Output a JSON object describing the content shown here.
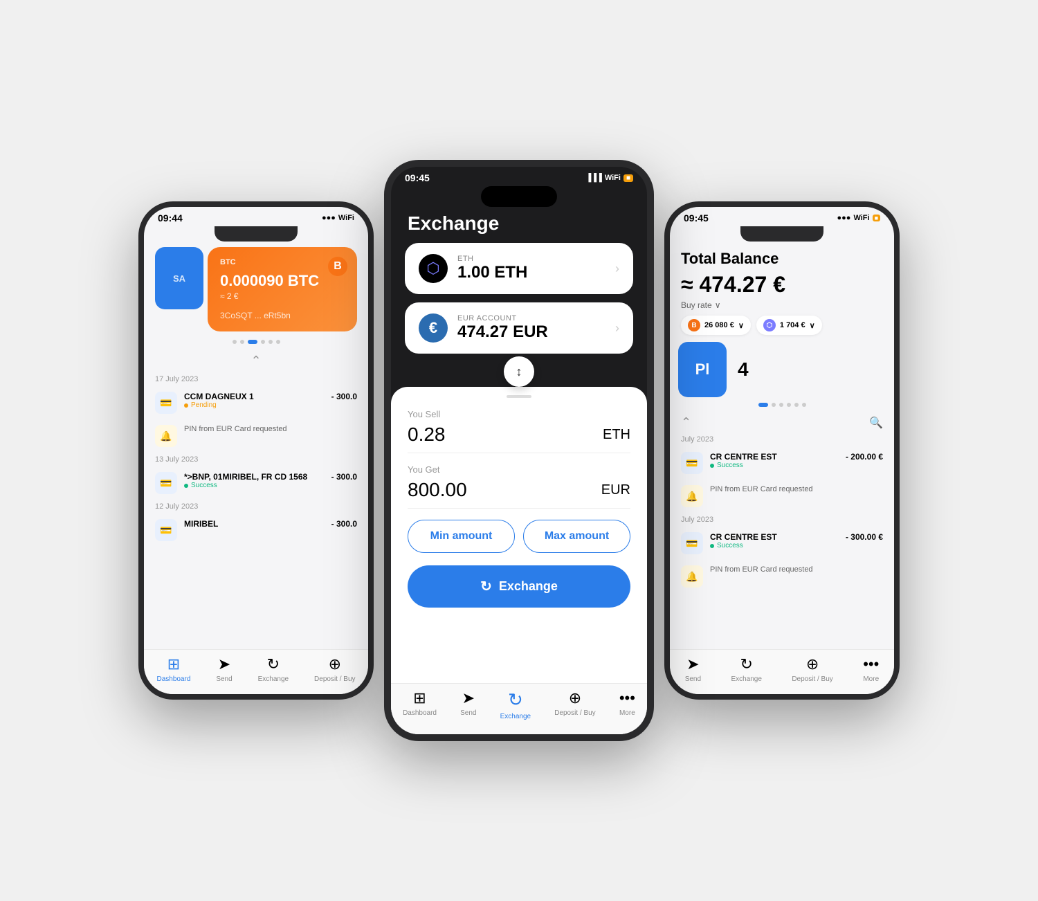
{
  "scene": {
    "background": "#e8e8ea"
  },
  "left_phone": {
    "status_time": "09:44",
    "status_signal": "●●●",
    "status_wifi": "WiFi",
    "card": {
      "label": "BTC",
      "badge": "B",
      "amount": "0.000090 BTC",
      "eur_approx": "≈ 2 €",
      "address": "3CoSQT ... eRt5bn"
    },
    "dots": [
      "dot",
      "dot",
      "dot-active",
      "dot",
      "dot",
      "dot"
    ],
    "transactions": [
      {
        "date": "17 July 2023",
        "items": [
          {
            "type": "card",
            "name": "CCM DAGNEUX 1",
            "amount": "- 300.0",
            "status": "Pending",
            "status_type": "pending"
          },
          {
            "type": "bell",
            "name": "PIN from EUR Card requested",
            "amount": "",
            "status": "",
            "status_type": "none"
          }
        ]
      },
      {
        "date": "13 July 2023",
        "items": [
          {
            "type": "card",
            "name": "*>BNP, 01MIRIBEL, FR CD 1568",
            "amount": "- 300.0",
            "status": "Success",
            "status_type": "success"
          }
        ]
      },
      {
        "date": "12 July 2023",
        "items": [
          {
            "type": "card",
            "name": "MIRIBEL",
            "amount": "- 300.0",
            "status": "",
            "status_type": "none"
          }
        ]
      }
    ],
    "nav_items": [
      {
        "icon": "⊞",
        "label": "Dashboard",
        "active": false
      },
      {
        "icon": "➤",
        "label": "Send",
        "active": false
      },
      {
        "icon": "↻",
        "label": "Exchange",
        "active": false
      },
      {
        "icon": "+",
        "label": "Deposit / Buy",
        "active": false
      }
    ]
  },
  "center_phone": {
    "status_time": "09:45",
    "header": "Exchange",
    "from_card": {
      "label": "ETH",
      "value": "1.00 ETH",
      "icon": "⬡"
    },
    "to_card": {
      "label": "EUR ACCOUNT",
      "value": "474.27 EUR",
      "icon": "€"
    },
    "swap_icon": "↕",
    "you_sell_label": "You Sell",
    "you_sell_value": "0.28",
    "you_sell_currency": "ETH",
    "you_get_label": "You Get",
    "you_get_value": "800.00",
    "you_get_currency": "EUR",
    "min_amount_label": "Min amount",
    "max_amount_label": "Max amount",
    "exchange_btn_label": "Exchange",
    "nav_items": [
      {
        "icon": "⊞",
        "label": "Dashboard",
        "active": false
      },
      {
        "icon": "➤",
        "label": "Send",
        "active": false
      },
      {
        "icon": "↻",
        "label": "Exchange",
        "active": true
      },
      {
        "icon": "+",
        "label": "Deposit / Buy",
        "active": false
      },
      {
        "icon": "•••",
        "label": "More",
        "active": false
      }
    ]
  },
  "right_phone": {
    "status_time": "09:45",
    "total_balance_label": "Total Balance",
    "total_balance_value": "≈ 474.27 €",
    "buy_rate_label": "Buy rate",
    "assets": [
      {
        "icon": "B",
        "color": "#f97316",
        "value": "26 080 €",
        "symbol": "BTC"
      },
      {
        "icon": "⬡",
        "color": "#7b7cff",
        "value": "1 704 €",
        "symbol": "ETH"
      }
    ],
    "dots": [
      "dot-active",
      "dot",
      "dot",
      "dot",
      "dot",
      "dot"
    ],
    "transactions": [
      {
        "date": "July 2023",
        "items": [
          {
            "type": "card",
            "name": "CR CENTRE EST",
            "amount": "- 200.00 €",
            "status": "Success",
            "status_type": "success"
          },
          {
            "type": "bell",
            "name": "PIN from EUR Card requested",
            "amount": "",
            "status": "",
            "status_type": "none"
          }
        ]
      },
      {
        "date": "July 2023",
        "items": [
          {
            "type": "card",
            "name": "CR CENTRE EST",
            "amount": "- 300.00 €",
            "status": "Success",
            "status_type": "success"
          },
          {
            "type": "bell",
            "name": "PIN from EUR Card requested",
            "amount": "",
            "status": "",
            "status_type": "none"
          }
        ]
      }
    ],
    "nav_items": [
      {
        "icon": "➤",
        "label": "Send",
        "active": false
      },
      {
        "icon": "↻",
        "label": "Exchange",
        "active": false
      },
      {
        "icon": "+",
        "label": "Deposit / Buy",
        "active": false
      },
      {
        "icon": "•••",
        "label": "More",
        "active": false
      }
    ]
  }
}
